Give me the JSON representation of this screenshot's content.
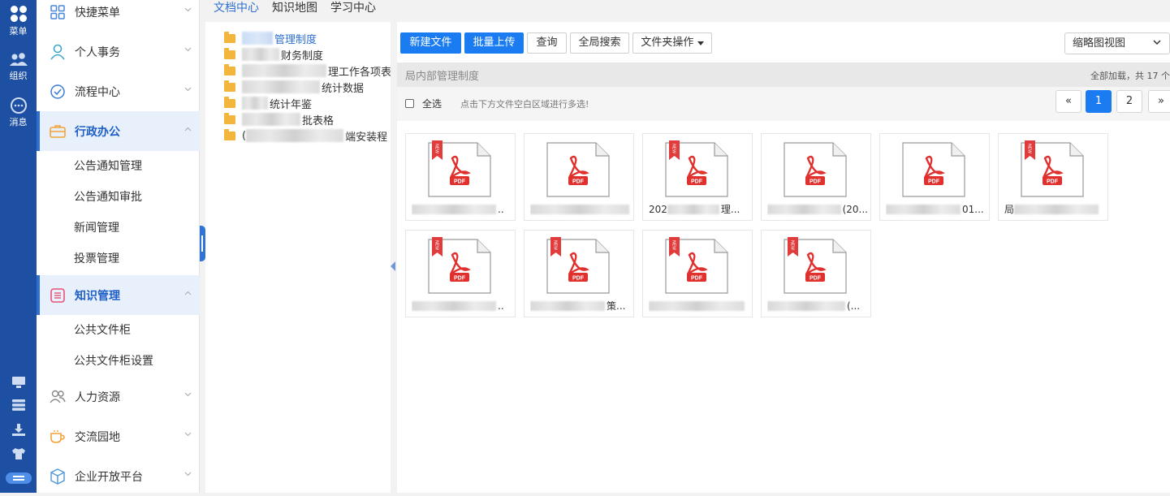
{
  "rail": {
    "items": [
      {
        "label": "菜单",
        "icon": "apps-grid-icon"
      },
      {
        "label": "组织",
        "icon": "people-icon"
      },
      {
        "label": "消息",
        "icon": "chat-bubble-icon"
      }
    ],
    "bottom_icons": [
      "monitor-icon",
      "stack-icon",
      "download-icon",
      "tshirt-icon",
      "more-icon"
    ]
  },
  "menu": {
    "items": [
      {
        "label": "快捷菜单",
        "icon": "shortcut-grid-icon"
      },
      {
        "label": "个人事务",
        "icon": "person-icon"
      },
      {
        "label": "流程中心",
        "icon": "workflow-icon"
      },
      {
        "label": "行政办公",
        "icon": "briefcase-icon",
        "active": true
      },
      {
        "label": "知识管理",
        "icon": "knowledge-icon",
        "active": true
      },
      {
        "label": "人力资源",
        "icon": "hr-people-icon"
      },
      {
        "label": "交流园地",
        "icon": "coffee-cup-icon"
      },
      {
        "label": "企业开放平台",
        "icon": "cube-icon"
      }
    ],
    "admin_sub": [
      "公告通知管理",
      "公告通知审批",
      "新闻管理",
      "投票管理"
    ],
    "knowledge_sub": [
      "公共文件柜",
      "公共文件柜设置"
    ]
  },
  "top_tabs": [
    "文档中心",
    "知识地图",
    "学习中心"
  ],
  "tree": {
    "nodes": [
      {
        "text": "管理制度",
        "selected": true
      },
      {
        "text": "财务制度"
      },
      {
        "text": "理工作各项表格"
      },
      {
        "text": "统计数据"
      },
      {
        "text": "统计年鉴"
      },
      {
        "text": "批表格"
      },
      {
        "text": "端安装程",
        "prefix": "("
      }
    ]
  },
  "toolbar": {
    "new_file": "新建文件",
    "batch_upload": "批量上传",
    "query": "查询",
    "global_search": "全局搜索",
    "folder_ops": "文件夹操作",
    "view_mode": "缩略图视图"
  },
  "path_bar": {
    "current_folder": "局内部管理制度",
    "load_status": "全部加载，共 17 个"
  },
  "selection": {
    "select_all": "全选",
    "hint": "点击下方文件空白区域进行多选!"
  },
  "pagination": {
    "prev": "«",
    "pages": [
      "1",
      "2"
    ],
    "next": "»",
    "current": "1"
  },
  "files": [
    {
      "name_visible": "..",
      "is_new": true
    },
    {
      "name_visible": "",
      "is_new": false
    },
    {
      "name_visible_prefix": "202",
      "name_visible": "理...",
      "is_new": true
    },
    {
      "name_visible": "(20...",
      "is_new": false
    },
    {
      "name_visible": "01...",
      "is_new": false
    },
    {
      "name_visible_prefix": "局",
      "name_visible": "",
      "is_new": true
    },
    {
      "name_visible": "..",
      "is_new": true
    },
    {
      "name_visible": "策...",
      "is_new": true
    },
    {
      "name_visible": "",
      "is_new": true
    },
    {
      "name_visible": "(...",
      "is_new": true
    }
  ],
  "file_type_label": "PDF",
  "new_badge": "NEW",
  "colors": {
    "rail_bg": "#1d4fa3",
    "primary": "#1a7cf0",
    "active_menu": "#1e5fc7",
    "folder": "#f3b53c",
    "pdf_red": "#e0312f"
  }
}
